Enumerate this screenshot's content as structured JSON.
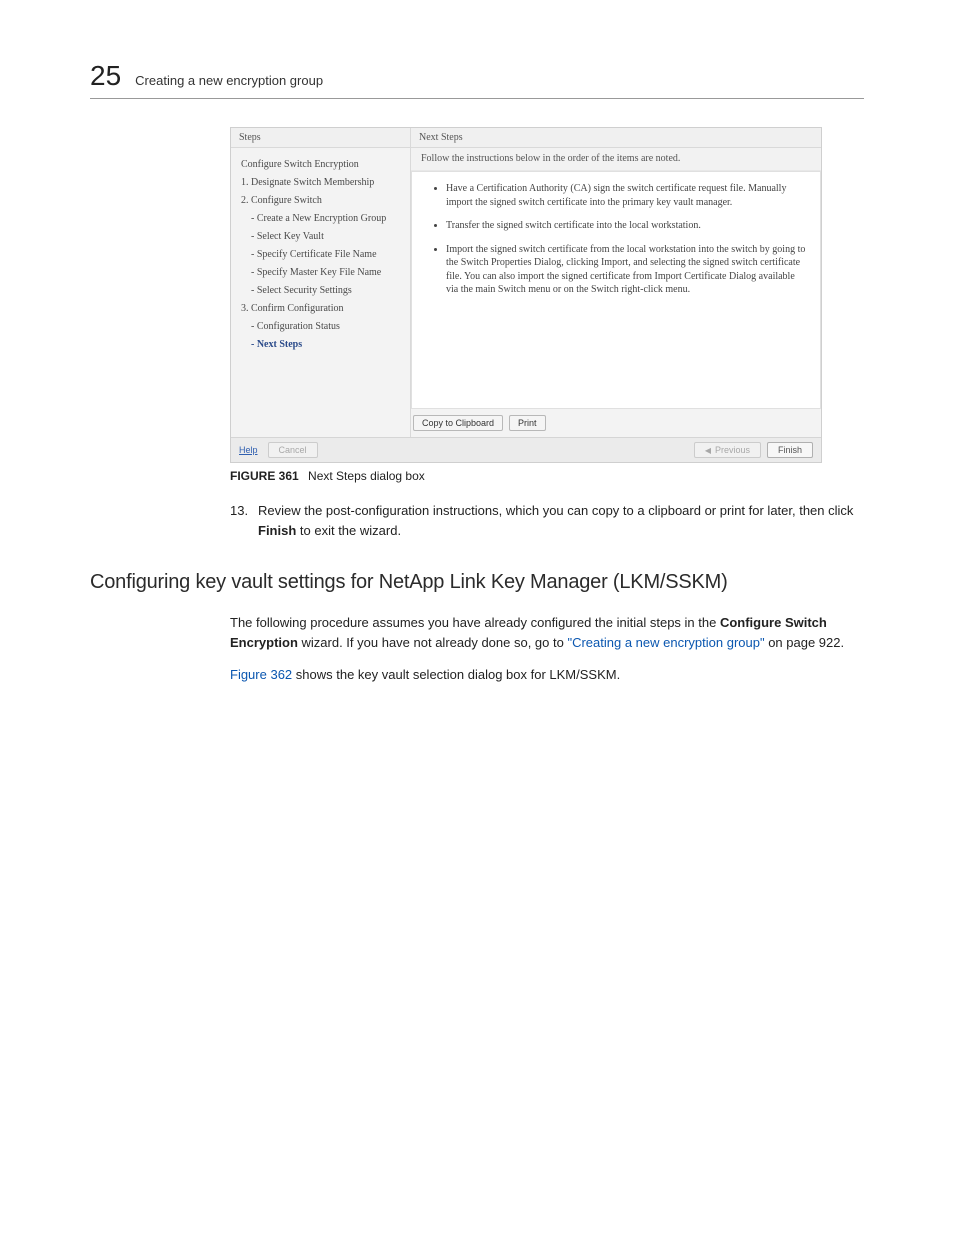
{
  "header": {
    "chapter_number": "25",
    "chapter_title": "Creating a new encryption group"
  },
  "dialog": {
    "steps_header": "Steps",
    "next_header": "Next Steps",
    "steps": {
      "s0": "Configure Switch Encryption",
      "s1": "1. Designate Switch Membership",
      "s2": "2. Configure Switch",
      "s2a": "- Create a New Encryption Group",
      "s2b": "- Select Key Vault",
      "s2c": "- Specify Certificate File Name",
      "s2d": "- Specify Master Key File Name",
      "s2e": "- Select Security Settings",
      "s3": "3. Confirm Configuration",
      "s3a": "- Configuration Status",
      "s3b": "- Next Steps"
    },
    "next_intro": "Follow the instructions below in the order of the items are noted.",
    "bullets": {
      "b1": "Have a Certification Authority (CA) sign the switch certificate request file. Manually import the signed switch certificate into the primary key vault manager.",
      "b2": "Transfer the signed switch certificate into the local workstation.",
      "b3": "Import the signed switch certificate from the local workstation into the switch by going to the Switch Properties Dialog, clicking Import, and selecting the signed switch certificate file. You can also import the signed certificate from Import Certificate Dialog available via the main Switch menu or on the Switch right-click menu."
    },
    "buttons": {
      "copy": "Copy to Clipboard",
      "print": "Print",
      "help": "Help",
      "cancel": "Cancel",
      "previous": "Previous",
      "finish": "Finish"
    }
  },
  "figure": {
    "label": "FIGURE 361",
    "caption": "Next Steps dialog box"
  },
  "step13": {
    "num": "13.",
    "text_a": "Review the post-configuration instructions, which you can copy to a clipboard or print for later, then click ",
    "bold": "Finish",
    "text_b": " to exit the wizard."
  },
  "section_heading": "Configuring key vault settings for NetApp Link Key Manager (LKM/SSKM)",
  "para1": {
    "a": "The following procedure assumes you have already configured the initial steps in the ",
    "b1": "Configure Switch Encryption",
    "b": " wizard. If you have not already done so, go to ",
    "link": "\"Creating a new encryption group\"",
    "c": " on page 922."
  },
  "para2": {
    "link": "Figure 362",
    "a": " shows the key vault selection dialog box for LKM/SSKM."
  }
}
